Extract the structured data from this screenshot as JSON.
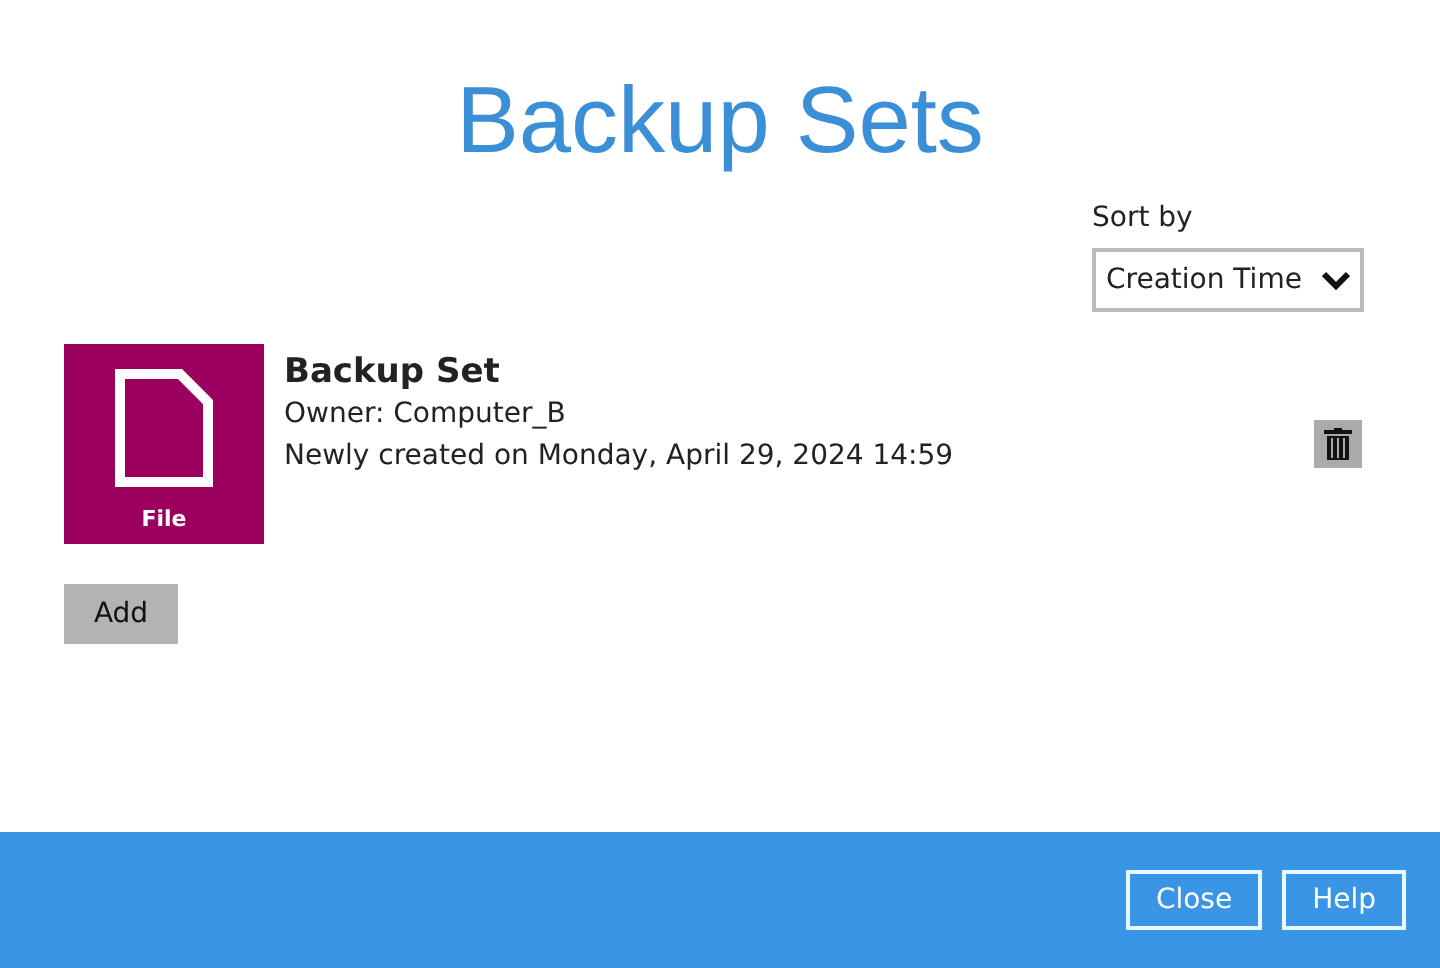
{
  "title": "Backup Sets",
  "sort": {
    "label": "Sort by",
    "value": "Creation Time"
  },
  "backup_sets": [
    {
      "type_label": "File",
      "name": "Backup Set",
      "owner": "Owner: Computer_B",
      "created": "Newly created on Monday, April 29, 2024 14:59"
    }
  ],
  "add_button": "Add",
  "footer_buttons": [
    "Close",
    "Help"
  ]
}
